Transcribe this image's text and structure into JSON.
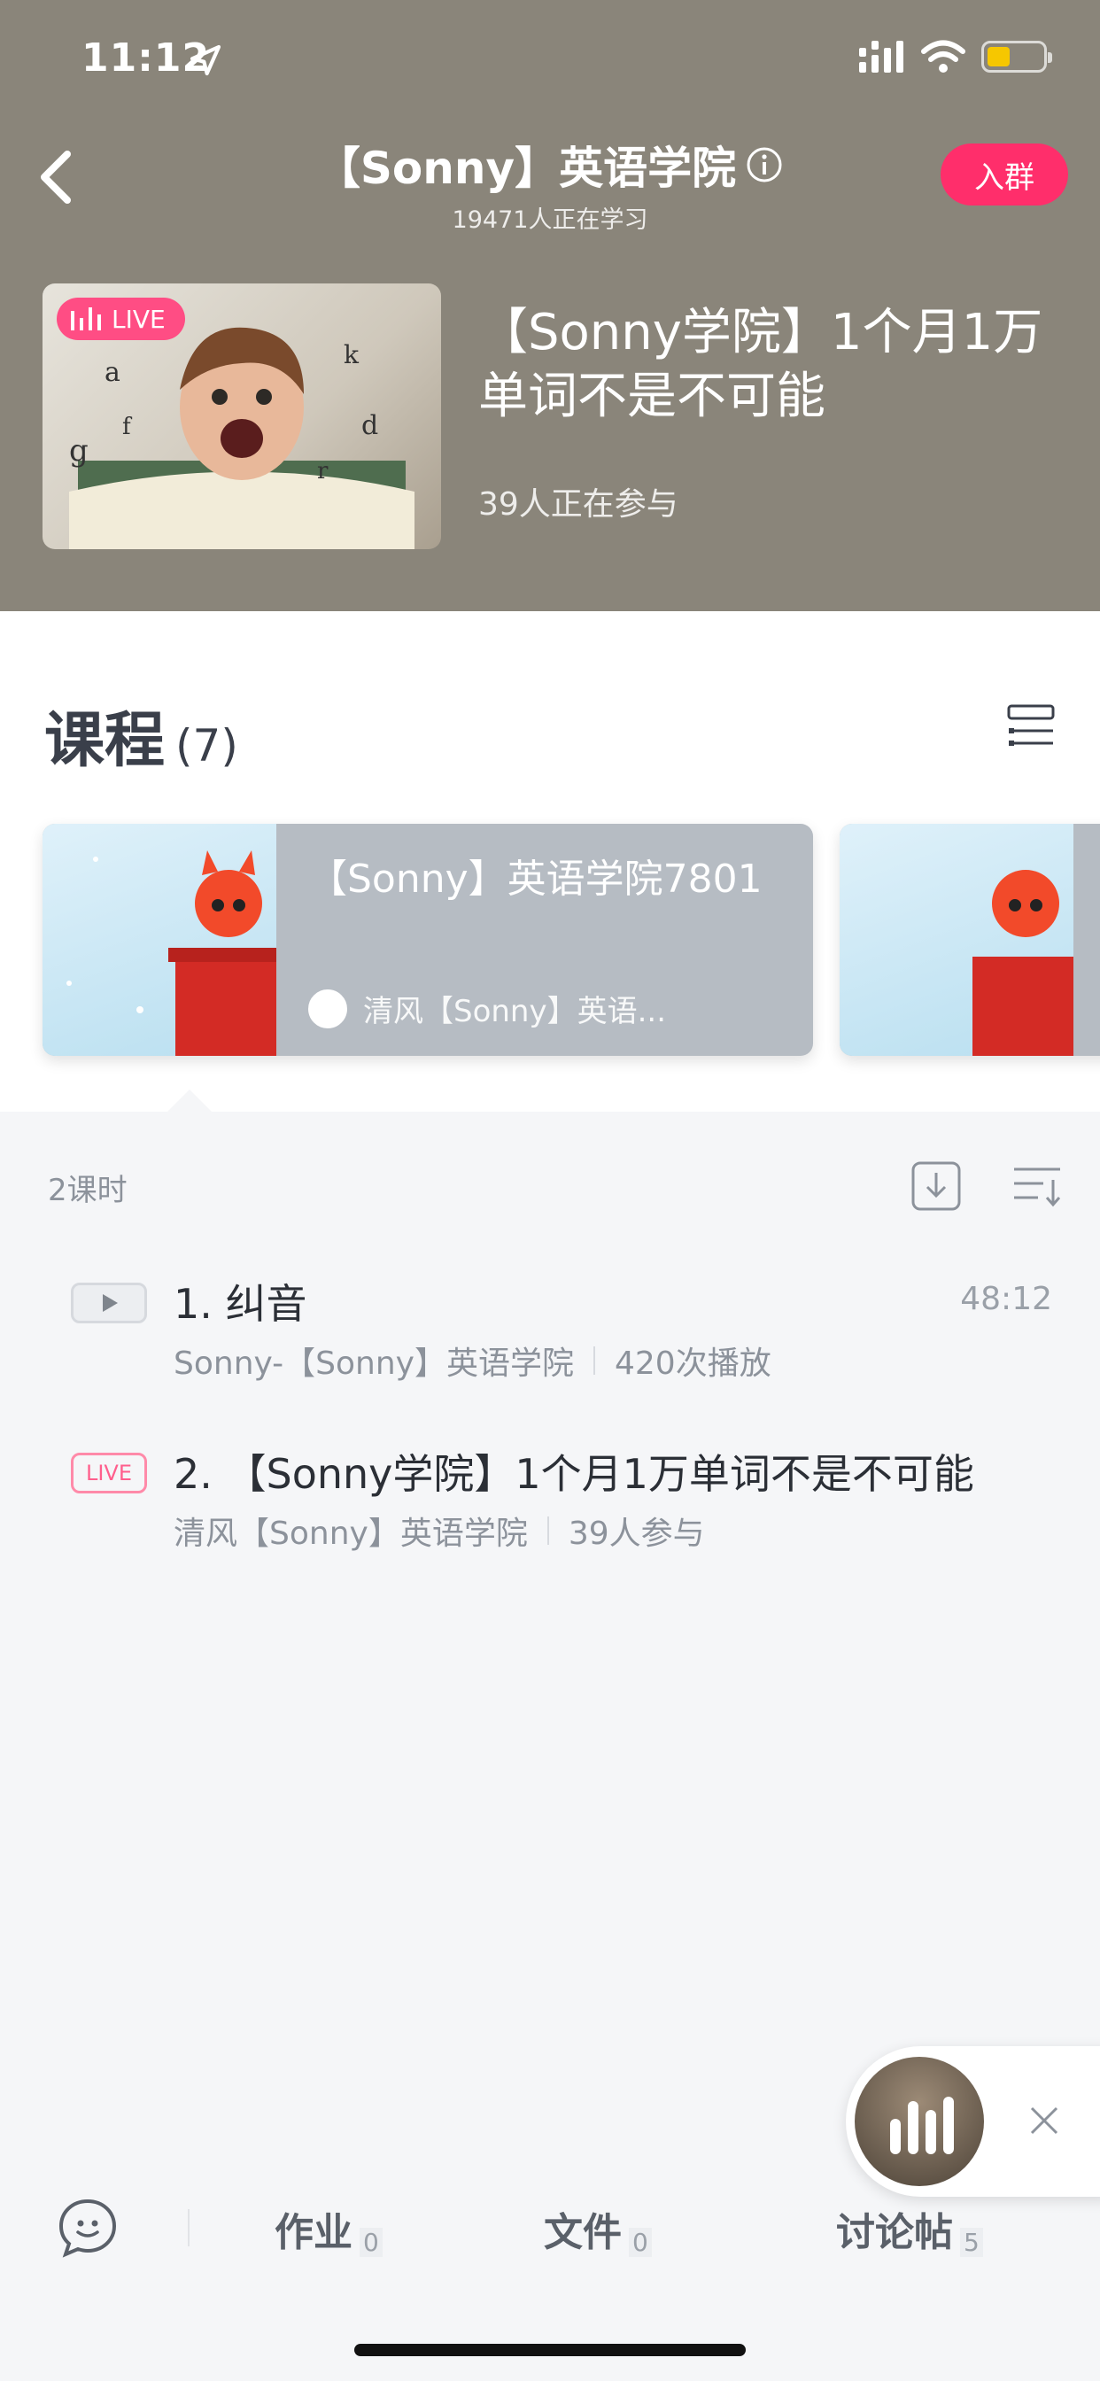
{
  "status_bar": {
    "time": "11:12"
  },
  "nav": {
    "title": "【Sonny】英语学院",
    "subtitle": "19471人正在学习",
    "join_label": "入群"
  },
  "live": {
    "badge": "LIVE",
    "title": "【Sonny学院】1个月1万单词不是不可能",
    "participants": "39人正在参与"
  },
  "courses": {
    "heading": "课程",
    "count": "(7)",
    "cards": [
      {
        "title": "【Sonny】英语学院7801",
        "author": "清风【Sonny】英语..."
      }
    ]
  },
  "lessons": {
    "count_label": "2课时",
    "items": [
      {
        "title": "1. 纠音",
        "author": "Sonny-【Sonny】英语学院",
        "stat": "420次播放",
        "duration": "48:12"
      },
      {
        "tag": "LIVE",
        "title": "2. 【Sonny学院】1个月1万单词不是不可能",
        "author": "清风【Sonny】英语学院",
        "stat": "39人参与"
      }
    ]
  },
  "bottom_tabs": [
    {
      "label": "作业",
      "count": "0"
    },
    {
      "label": "文件",
      "count": "0"
    },
    {
      "label": "讨论帖",
      "count": "5"
    }
  ],
  "colors": {
    "header_bg": "#8a857a",
    "accent_pink": "#ff2e6b",
    "battery_yellow": "#f6c700"
  },
  "icons": [
    "location-arrow-icon",
    "signal-icon",
    "wifi-icon",
    "battery-icon",
    "back-arrow-icon",
    "info-icon",
    "live-bars-icon",
    "list-view-icon",
    "download-icon",
    "sort-icon",
    "play-icon",
    "close-icon",
    "chat-icon"
  ]
}
